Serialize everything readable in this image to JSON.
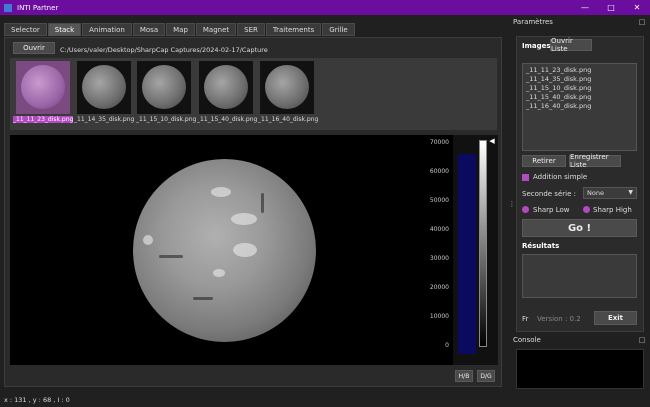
{
  "window": {
    "title": "INTI Partner"
  },
  "tabs": [
    "Selector",
    "Stack",
    "Animation",
    "Mosa",
    "Map",
    "Magnet",
    "SER",
    "Traitements",
    "Grille"
  ],
  "active_tab": "Stack",
  "stack": {
    "open_label": "Ouvrir",
    "path": "C:/Users/valer/Desktop/SharpCap Captures/2024-02-17/Capture",
    "thumbnails": [
      "_11_11_23_disk.png",
      "_11_14_35_disk.png",
      "_11_15_10_disk.png",
      "_11_15_40_disk.png",
      "_11_16_40_disk.png"
    ],
    "histogram_ticks": [
      "70000",
      "60000",
      "50000",
      "40000",
      "30000",
      "20000",
      "10000",
      "0"
    ],
    "hb_label": "H/B",
    "dg_label": "D/G"
  },
  "params": {
    "title": "Paramètres",
    "images_label": "Images",
    "open_list_label": "Ouvrir Liste",
    "images": [
      "_11_11_23_disk.png",
      "_11_14_35_disk.png",
      "_11_15_10_disk.png",
      "_11_15_40_disk.png",
      "_11_16_40_disk.png"
    ],
    "remove_label": "Retirer",
    "save_list_label": "Enregistrer Liste",
    "simple_add_label": "Addition simple",
    "second_series_label": "Seconde série :",
    "second_series_value": "None",
    "sharp_low_label": "Sharp Low",
    "sharp_high_label": "Sharp High",
    "go_label": "Go !",
    "results_label": "Résultats",
    "lang": "Fr",
    "version": "Version : 0.2",
    "exit_label": "Exit"
  },
  "console": {
    "title": "Console"
  },
  "status": {
    "text": "x : 131 , y : 68 , I : 0"
  },
  "colors": {
    "titlebar": "#6b0ea0",
    "accent": "#b548c4"
  }
}
